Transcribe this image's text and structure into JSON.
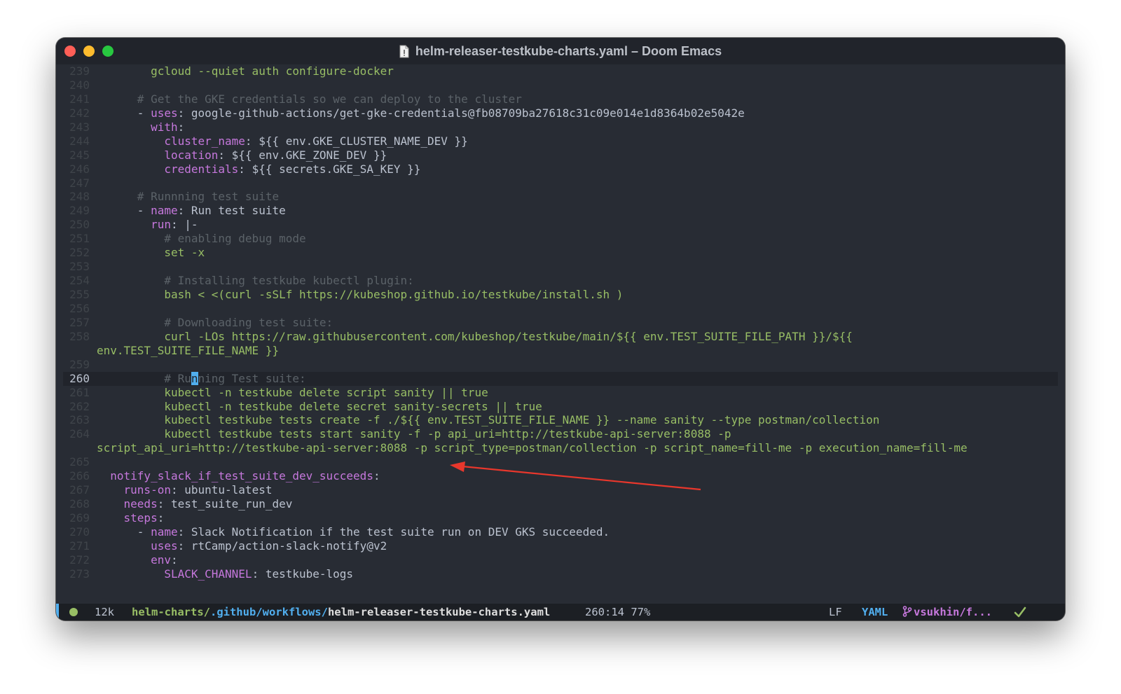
{
  "window": {
    "title": "helm-releaser-testkube-charts.yaml – Doom Emacs",
    "icons": {
      "file": "document-icon",
      "branch": "git-branch-icon",
      "status": "checkmark-icon"
    }
  },
  "editor": {
    "current_line": 260,
    "lines": [
      {
        "n": "239",
        "cur": false,
        "segs": [
          {
            "t": "        ",
            "c": "p"
          },
          {
            "t": "gcloud --quiet auth configure-docker",
            "c": "s"
          }
        ]
      },
      {
        "n": "240",
        "cur": false,
        "segs": []
      },
      {
        "n": "241",
        "cur": false,
        "segs": [
          {
            "t": "      ",
            "c": "p"
          },
          {
            "t": "# Get the GKE credentials so we can deploy to the cluster",
            "c": "c"
          }
        ]
      },
      {
        "n": "242",
        "cur": false,
        "segs": [
          {
            "t": "      - ",
            "c": "p"
          },
          {
            "t": "uses",
            "c": "k"
          },
          {
            "t": ": google-github-actions/get-gke-credentials@fb08709ba27618c31c09e014e1d8364b02e5042e",
            "c": "p"
          }
        ]
      },
      {
        "n": "243",
        "cur": false,
        "segs": [
          {
            "t": "        ",
            "c": "p"
          },
          {
            "t": "with",
            "c": "k"
          },
          {
            "t": ":",
            "c": "p"
          }
        ]
      },
      {
        "n": "244",
        "cur": false,
        "segs": [
          {
            "t": "          ",
            "c": "p"
          },
          {
            "t": "cluster_name",
            "c": "k"
          },
          {
            "t": ": ${{ env.GKE_CLUSTER_NAME_DEV }}",
            "c": "p"
          }
        ]
      },
      {
        "n": "245",
        "cur": false,
        "segs": [
          {
            "t": "          ",
            "c": "p"
          },
          {
            "t": "location",
            "c": "k"
          },
          {
            "t": ": ${{ env.GKE_ZONE_DEV }}",
            "c": "p"
          }
        ]
      },
      {
        "n": "246",
        "cur": false,
        "segs": [
          {
            "t": "          ",
            "c": "p"
          },
          {
            "t": "credentials",
            "c": "k"
          },
          {
            "t": ": ${{ secrets.GKE_SA_KEY }}",
            "c": "p"
          }
        ]
      },
      {
        "n": "247",
        "cur": false,
        "segs": []
      },
      {
        "n": "248",
        "cur": false,
        "segs": [
          {
            "t": "      ",
            "c": "p"
          },
          {
            "t": "# Runnning test suite",
            "c": "c"
          }
        ]
      },
      {
        "n": "249",
        "cur": false,
        "segs": [
          {
            "t": "      - ",
            "c": "p"
          },
          {
            "t": "name",
            "c": "k"
          },
          {
            "t": ": Run test suite",
            "c": "p"
          }
        ]
      },
      {
        "n": "250",
        "cur": false,
        "segs": [
          {
            "t": "        ",
            "c": "p"
          },
          {
            "t": "run",
            "c": "k"
          },
          {
            "t": ": |-",
            "c": "p"
          }
        ]
      },
      {
        "n": "251",
        "cur": false,
        "segs": [
          {
            "t": "          ",
            "c": "p"
          },
          {
            "t": "# enabling debug mode",
            "c": "c"
          }
        ]
      },
      {
        "n": "252",
        "cur": false,
        "segs": [
          {
            "t": "          ",
            "c": "p"
          },
          {
            "t": "set -x",
            "c": "s"
          }
        ]
      },
      {
        "n": "253",
        "cur": false,
        "segs": []
      },
      {
        "n": "254",
        "cur": false,
        "segs": [
          {
            "t": "          ",
            "c": "p"
          },
          {
            "t": "# Installing testkube kubectl plugin:",
            "c": "c"
          }
        ]
      },
      {
        "n": "255",
        "cur": false,
        "segs": [
          {
            "t": "          ",
            "c": "p"
          },
          {
            "t": "bash < <(curl -sSLf https://kubeshop.github.io/testkube/install.sh )",
            "c": "s"
          }
        ]
      },
      {
        "n": "256",
        "cur": false,
        "segs": []
      },
      {
        "n": "257",
        "cur": false,
        "segs": [
          {
            "t": "          ",
            "c": "p"
          },
          {
            "t": "# Downloading test suite:",
            "c": "c"
          }
        ]
      },
      {
        "n": "258",
        "cur": false,
        "segs": [
          {
            "t": "          ",
            "c": "p"
          },
          {
            "t": "curl -LOs https://raw.githubusercontent.com/kubeshop/testkube/main/${{ env.TEST_SUITE_FILE_PATH }}/${{",
            "c": "s"
          }
        ]
      },
      {
        "n": "",
        "cur": false,
        "segs": [
          {
            "t": "env.TEST_SUITE_FILE_NAME }}",
            "c": "s"
          }
        ]
      },
      {
        "n": "259",
        "cur": false,
        "segs": []
      },
      {
        "n": "260",
        "cur": true,
        "segs": [
          {
            "t": "          ",
            "c": "p"
          },
          {
            "t": "# Ru",
            "c": "c"
          },
          {
            "t": "n",
            "c": "cursor"
          },
          {
            "t": "ning Test suite:",
            "c": "c"
          }
        ]
      },
      {
        "n": "261",
        "cur": false,
        "segs": [
          {
            "t": "          ",
            "c": "p"
          },
          {
            "t": "kubectl -n testkube delete script sanity || true",
            "c": "s"
          }
        ]
      },
      {
        "n": "262",
        "cur": false,
        "segs": [
          {
            "t": "          ",
            "c": "p"
          },
          {
            "t": "kubectl -n testkube delete secret sanity-secrets || true",
            "c": "s"
          }
        ]
      },
      {
        "n": "263",
        "cur": false,
        "segs": [
          {
            "t": "          ",
            "c": "p"
          },
          {
            "t": "kubectl testkube tests create -f ./${{ env.TEST_SUITE_FILE_NAME }} --name sanity --type postman/collection",
            "c": "s"
          }
        ]
      },
      {
        "n": "264",
        "cur": false,
        "segs": [
          {
            "t": "          ",
            "c": "p"
          },
          {
            "t": "kubectl testkube tests start sanity -f -p api_uri=http://testkube-api-server:8088 -p",
            "c": "s"
          }
        ]
      },
      {
        "n": "",
        "cur": false,
        "segs": [
          {
            "t": "script_api_uri=http://testkube-api-server:8088 -p script_type=postman/collection -p script_name=fill-me -p execution_name=fill-me",
            "c": "s"
          }
        ]
      },
      {
        "n": "265",
        "cur": false,
        "segs": []
      },
      {
        "n": "266",
        "cur": false,
        "segs": [
          {
            "t": "  ",
            "c": "p"
          },
          {
            "t": "notify_slack_if_test_suite_dev_succeeds",
            "c": "k"
          },
          {
            "t": ":",
            "c": "p"
          }
        ]
      },
      {
        "n": "267",
        "cur": false,
        "segs": [
          {
            "t": "    ",
            "c": "p"
          },
          {
            "t": "runs-on",
            "c": "k"
          },
          {
            "t": ": ubuntu-latest",
            "c": "p"
          }
        ]
      },
      {
        "n": "268",
        "cur": false,
        "segs": [
          {
            "t": "    ",
            "c": "p"
          },
          {
            "t": "needs",
            "c": "k"
          },
          {
            "t": ": test_suite_run_dev",
            "c": "p"
          }
        ]
      },
      {
        "n": "269",
        "cur": false,
        "segs": [
          {
            "t": "    ",
            "c": "p"
          },
          {
            "t": "steps",
            "c": "k"
          },
          {
            "t": ":",
            "c": "p"
          }
        ]
      },
      {
        "n": "270",
        "cur": false,
        "segs": [
          {
            "t": "      - ",
            "c": "p"
          },
          {
            "t": "name",
            "c": "k"
          },
          {
            "t": ": Slack Notification if the test suite run on DEV GKS succeeded.",
            "c": "p"
          }
        ]
      },
      {
        "n": "271",
        "cur": false,
        "segs": [
          {
            "t": "        ",
            "c": "p"
          },
          {
            "t": "uses",
            "c": "k"
          },
          {
            "t": ": rtCamp/action-slack-notify@v2",
            "c": "p"
          }
        ]
      },
      {
        "n": "272",
        "cur": false,
        "segs": [
          {
            "t": "        ",
            "c": "p"
          },
          {
            "t": "env",
            "c": "k"
          },
          {
            "t": ":",
            "c": "p"
          }
        ]
      },
      {
        "n": "273",
        "cur": false,
        "segs": [
          {
            "t": "          ",
            "c": "p"
          },
          {
            "t": "SLACK_CHANNEL",
            "c": "k"
          },
          {
            "t": ": testkube-logs",
            "c": "p"
          }
        ]
      }
    ]
  },
  "modeline": {
    "size": "12k",
    "path_dir": "helm-charts/",
    "path_github": ".github/workflows/",
    "path_file": "helm-releaser-testkube-charts.yaml",
    "position": "260:14 77%",
    "eol": "LF",
    "mode": "YAML",
    "branch": "vsukhin/f...",
    "colors": {
      "accent": "#51afef",
      "ok": "#98be65",
      "keyword": "#c678dd",
      "annotation": "#e8372c"
    }
  }
}
